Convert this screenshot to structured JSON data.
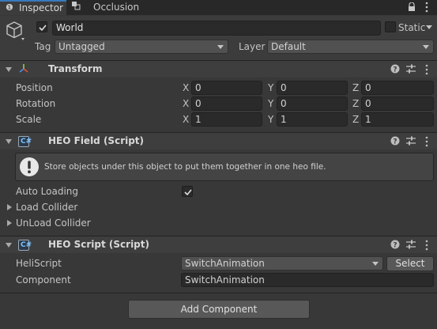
{
  "tabs": [
    {
      "label": "Inspector",
      "active": true
    },
    {
      "label": "Occlusion",
      "active": false
    }
  ],
  "object": {
    "active": true,
    "name": "World",
    "static_label": "Static",
    "tag_label": "Tag",
    "tag_value": "Untagged",
    "layer_label": "Layer",
    "layer_value": "Default"
  },
  "transform": {
    "title": "Transform",
    "rows": [
      {
        "label": "Position",
        "x": "0",
        "y": "0",
        "z": "0"
      },
      {
        "label": "Rotation",
        "x": "0",
        "y": "0",
        "z": "0"
      },
      {
        "label": "Scale",
        "x": "1",
        "y": "1",
        "z": "1"
      }
    ],
    "axis_x": "X",
    "axis_y": "Y",
    "axis_z": "Z"
  },
  "heo_field": {
    "title": "HEO Field (Script)",
    "info": "Store objects under this object to put them together in one heo file.",
    "auto_loading_label": "Auto Loading",
    "auto_loading": true,
    "load_collider_label": "Load Collider",
    "unload_collider_label": "UnLoad Collider"
  },
  "heo_script": {
    "title": "HEO Script (Script)",
    "heliscript_label": "HeliScript",
    "heliscript_value": "SwitchAnimation",
    "select_label": "Select",
    "component_label": "Component",
    "component_value": "SwitchAnimation"
  },
  "add_component_label": "Add Component",
  "colors": {
    "background": "#383838",
    "header": "#3e3e3e",
    "field": "#2a2a2a",
    "accent_blue": "#7cc0ff"
  }
}
